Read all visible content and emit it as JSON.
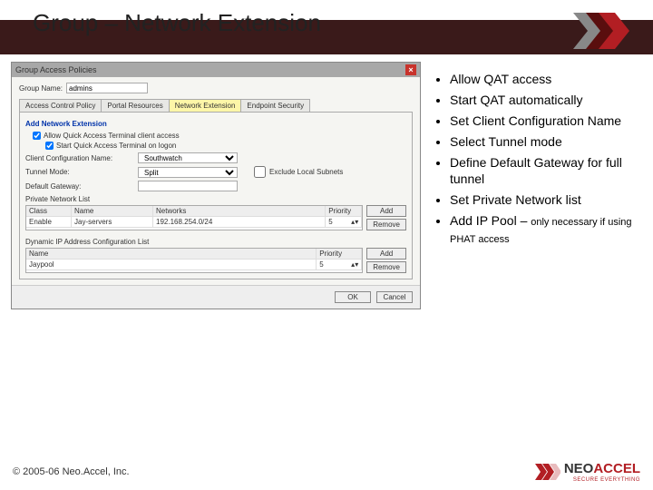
{
  "slide": {
    "title": "Group – Network Extension",
    "copyright": "© 2005-06 Neo.Accel, Inc."
  },
  "bullets": [
    {
      "text": "Allow QAT access"
    },
    {
      "text": "Start QAT automatically"
    },
    {
      "text": "Set Client Configuration Name"
    },
    {
      "text": "Select Tunnel mode"
    },
    {
      "text": "Define Default Gateway for full tunnel"
    },
    {
      "text": "Set Private Network list"
    },
    {
      "text": "Add IP Pool – ",
      "sub": "only necessary if using PHAT access"
    }
  ],
  "dialog": {
    "title": "Group Access Policies",
    "group_name_label": "Group Name:",
    "group_name_value": "admins",
    "tabs": [
      "Access Control Policy",
      "Portal Resources",
      "Network Extension",
      "Endpoint Security"
    ],
    "section_add": "Add Network Extension",
    "chk_allow": "Allow Quick Access Terminal client access",
    "chk_start": "Start Quick Access Terminal on logon",
    "client_conf_label": "Client Configuration Name:",
    "client_conf_value": "Southwatch",
    "tunnel_label": "Tunnel Mode:",
    "tunnel_value": "Split",
    "exclude_label": "Exclude Local Subnets",
    "gateway_label": "Default Gateway:",
    "priv_label": "Private Network List",
    "net_table": {
      "head": [
        "Class",
        "Name",
        "Networks",
        "Priority"
      ],
      "rows": [
        [
          "Enable",
          "Jay-servers",
          "192.168.254.0/24",
          "5"
        ]
      ]
    },
    "btn_add": "Add",
    "btn_remove": "Remove",
    "dyn_label": "Dynamic IP Address Configuration List",
    "ip_table": {
      "head": [
        "Name",
        "Priority"
      ],
      "rows": [
        [
          "Jaypool",
          "5"
        ]
      ]
    },
    "ok": "OK",
    "cancel": "Cancel"
  },
  "logo": {
    "neo": "NEO",
    "accel": "ACCEL",
    "tag": "SECURE EVERYTHING"
  }
}
